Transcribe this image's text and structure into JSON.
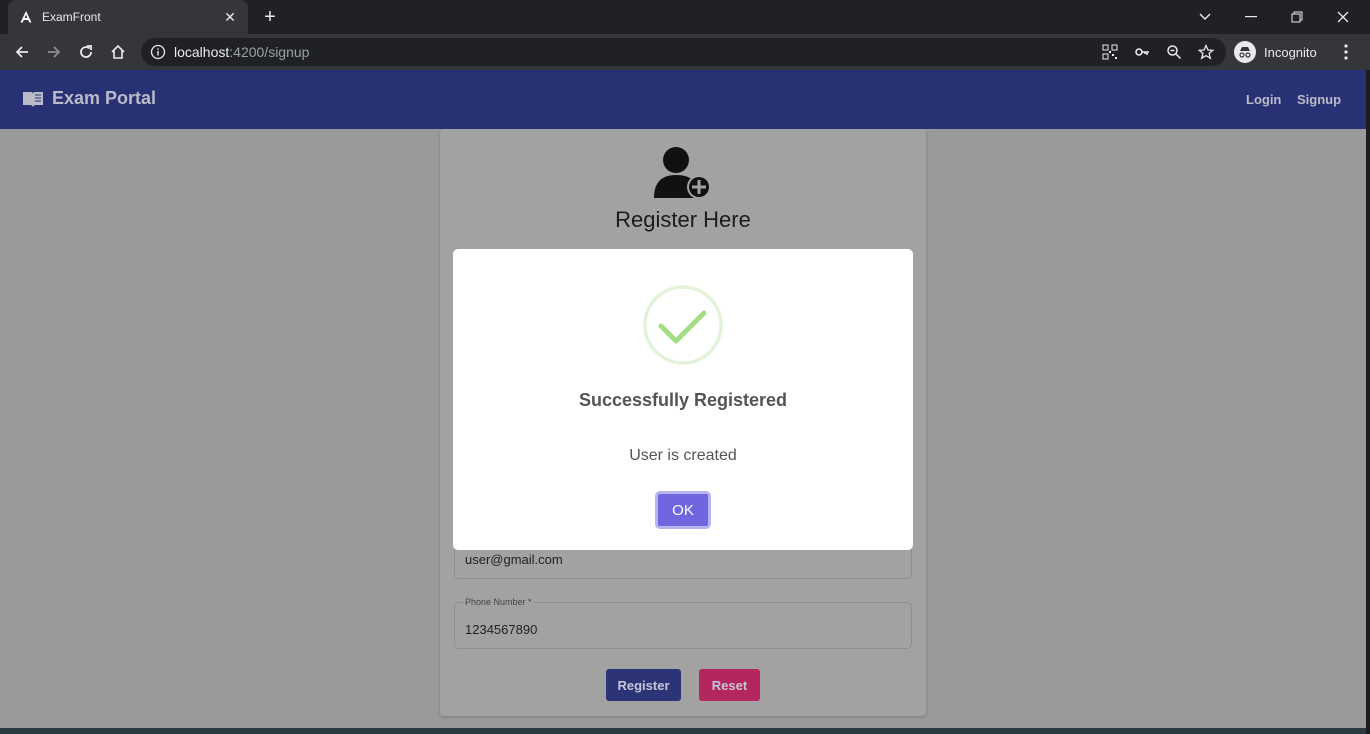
{
  "browser": {
    "tab_title": "ExamFront",
    "url_host": "localhost",
    "url_path": ":4200/signup",
    "profile_label": "Incognito"
  },
  "app": {
    "brand": "Exam Portal",
    "nav": [
      "Login",
      "Signup"
    ]
  },
  "form": {
    "title": "Register Here",
    "email_value": "user@gmail.com",
    "phone_label": "Phone Number *",
    "phone_value": "1234567890",
    "register_label": "Register",
    "reset_label": "Reset",
    "register_color": "#2c3477",
    "reset_color": "#b3265e"
  },
  "dialog": {
    "title": "Successfully Registered",
    "text": "User is created",
    "ok_label": "OK",
    "icon": "success-check-icon",
    "accent": "#7066e0",
    "check_color": "#a5dc86"
  }
}
